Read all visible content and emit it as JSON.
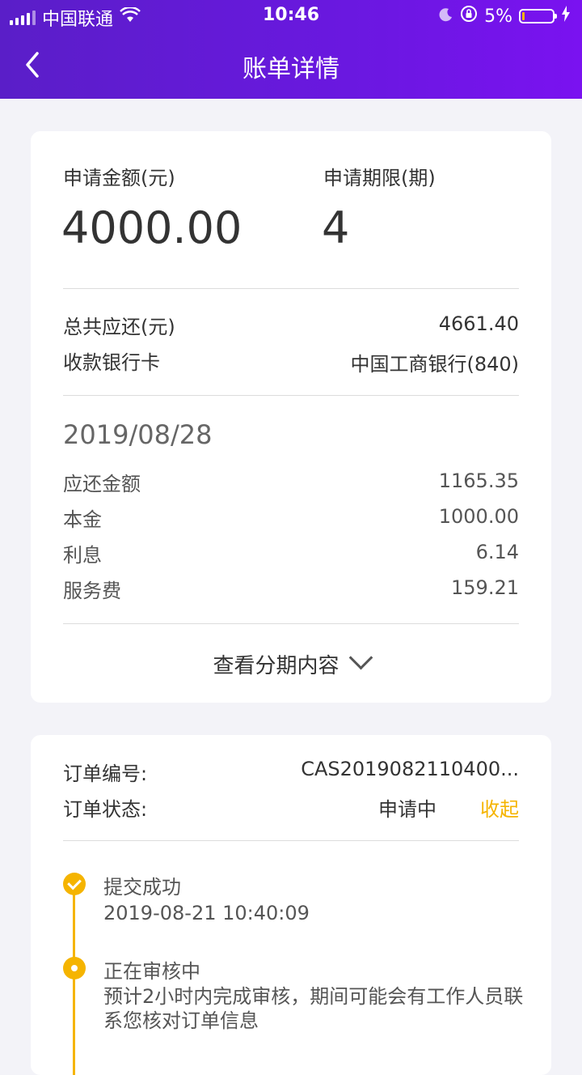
{
  "status_bar": {
    "carrier": "中国联通",
    "time": "10:46",
    "battery": "5%"
  },
  "nav": {
    "title": "账单详情"
  },
  "summary": {
    "amount_label": "申请金额(元)",
    "amount_value": "4000.00",
    "term_label": "申请期限(期)",
    "term_value": "4",
    "total_label": "总共应还(元)",
    "total_value": "4661.40",
    "bank_label": "收款银行卡",
    "bank_value": "中国工商银行(840)"
  },
  "installment": {
    "date": "2019/08/28",
    "rows": [
      {
        "label": "应还金额",
        "value": "1165.35"
      },
      {
        "label": "本金",
        "value": "1000.00"
      },
      {
        "label": "利息",
        "value": "6.14"
      },
      {
        "label": "服务费",
        "value": "159.21"
      }
    ],
    "expand_label": "查看分期内容"
  },
  "order": {
    "number_label": "订单编号:",
    "number_value": "CAS2019082110400...",
    "status_label": "订单状态:",
    "status_value": "申请中",
    "collapse_label": "收起",
    "timeline": [
      {
        "title": "提交成功",
        "detail": "2019-08-21 10:40:09"
      },
      {
        "title": "正在审核中",
        "detail": "预计2小时内完成审核，期间可能会有工作人员联系您核对订单信息"
      }
    ]
  },
  "colors": {
    "header_start": "#5a1ec8",
    "header_end": "#7a12f0",
    "accent": "#f5b400"
  }
}
